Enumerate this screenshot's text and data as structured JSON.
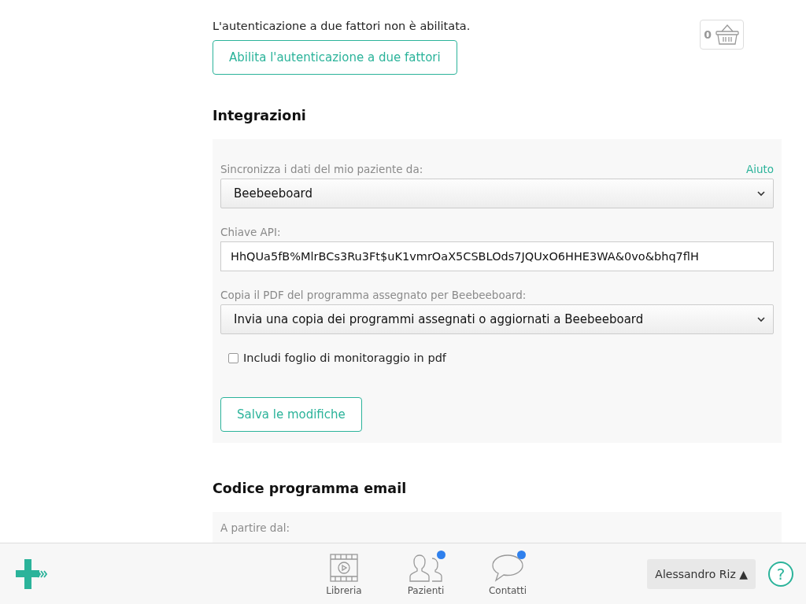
{
  "two_factor": {
    "status_text": "L'autenticazione a due fattori non è abilitata.",
    "button": "Abilita l'autenticazione a due fattori"
  },
  "cart": {
    "count": "0"
  },
  "integrations": {
    "title": "Integrazioni",
    "help_link": "Aiuto",
    "fields": [
      {
        "kind": "select",
        "label": "Sincronizza i dati del mio paziente da:",
        "value": "Beebeeboard"
      },
      {
        "kind": "text",
        "label": "Chiave API:",
        "value": "HhQUa5fB%MlrBCs3Ru3Ft$uK1vmrOaX5CSBLOds7JQUxO6HHE3WA&0vo&bhq7flH"
      },
      {
        "kind": "select",
        "label": "Copia il PDF del programma assegnato per Beebeeboard:",
        "value": "Invia una copia dei programmi assegnati o aggiornati a Beebeeboard"
      },
      {
        "kind": "checkbox",
        "label": "Includi foglio di monitoraggio in pdf",
        "checked": false
      }
    ],
    "save_button": "Salva le modifiche"
  },
  "email_code": {
    "title": "Codice programma email",
    "field_label": "A partire dal:"
  },
  "bottom_bar": {
    "nav": [
      {
        "kind": "library",
        "label": "Libreria",
        "notification": false
      },
      {
        "kind": "patients",
        "label": "Pazienti",
        "notification": true
      },
      {
        "kind": "contacts",
        "label": "Contatti",
        "notification": true
      }
    ],
    "user_button": "Alessandro Riz ▲",
    "help": "?"
  }
}
